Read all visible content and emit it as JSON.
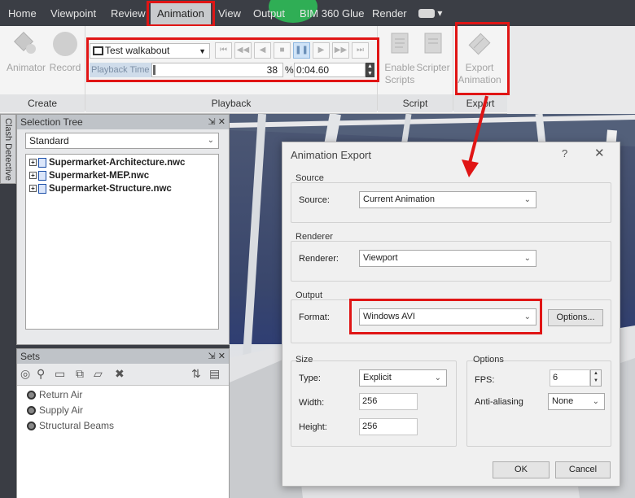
{
  "menubar": {
    "tabs": [
      "Home",
      "Viewpoint",
      "Review",
      "Animation",
      "View",
      "Output",
      "BIM 360 Glue",
      "Render"
    ],
    "active_tab": "Animation"
  },
  "ribbon": {
    "create": {
      "group_label": "Create",
      "animator_label": "Animator",
      "record_label": "Record"
    },
    "playback": {
      "group_label": "Playback",
      "animation_select": "Test walkabout",
      "playback_time_label": "Playback Time",
      "percent_value": "38",
      "percent_symbol": "%",
      "time_value": "0:04.60",
      "progress_fraction": 0.38
    },
    "script": {
      "group_label": "Script",
      "enable_scripts_line1": "Enable",
      "enable_scripts_line2": "Scripts",
      "scripter_label": "Scripter"
    },
    "export": {
      "group_label": "Export",
      "export_line1": "Export",
      "export_line2": "Animation"
    }
  },
  "side_tab": {
    "clash_detective": "Clash Detective"
  },
  "selection_tree": {
    "title": "Selection Tree",
    "filter": "Standard",
    "items": [
      "Supermarket-Architecture.nwc",
      "Supermarket-MEP.nwc",
      "Supermarket-Structure.nwc"
    ]
  },
  "sets": {
    "title": "Sets",
    "items": [
      "Return Air",
      "Supply Air",
      "Structural Beams"
    ]
  },
  "dialog": {
    "title": "Animation Export",
    "help": "?",
    "close": "✕",
    "source": {
      "title": "Source",
      "label": "Source:",
      "value": "Current Animation"
    },
    "renderer": {
      "title": "Renderer",
      "label": "Renderer:",
      "value": "Viewport"
    },
    "output": {
      "title": "Output",
      "label": "Format:",
      "value": "Windows AVI",
      "options_button": "Options..."
    },
    "size": {
      "title": "Size",
      "type_label": "Type:",
      "type_value": "Explicit",
      "width_label": "Width:",
      "width_value": "256",
      "height_label": "Height:",
      "height_value": "256"
    },
    "options": {
      "title": "Options",
      "fps_label": "FPS:",
      "fps_value": "6",
      "aa_label": "Anti-aliasing",
      "aa_value": "None"
    },
    "ok": "OK",
    "cancel": "Cancel"
  },
  "colors": {
    "highlight_red": "#e01515",
    "menubar_bg": "#3b3e45",
    "ribbon_bg": "#f4f4f4"
  }
}
